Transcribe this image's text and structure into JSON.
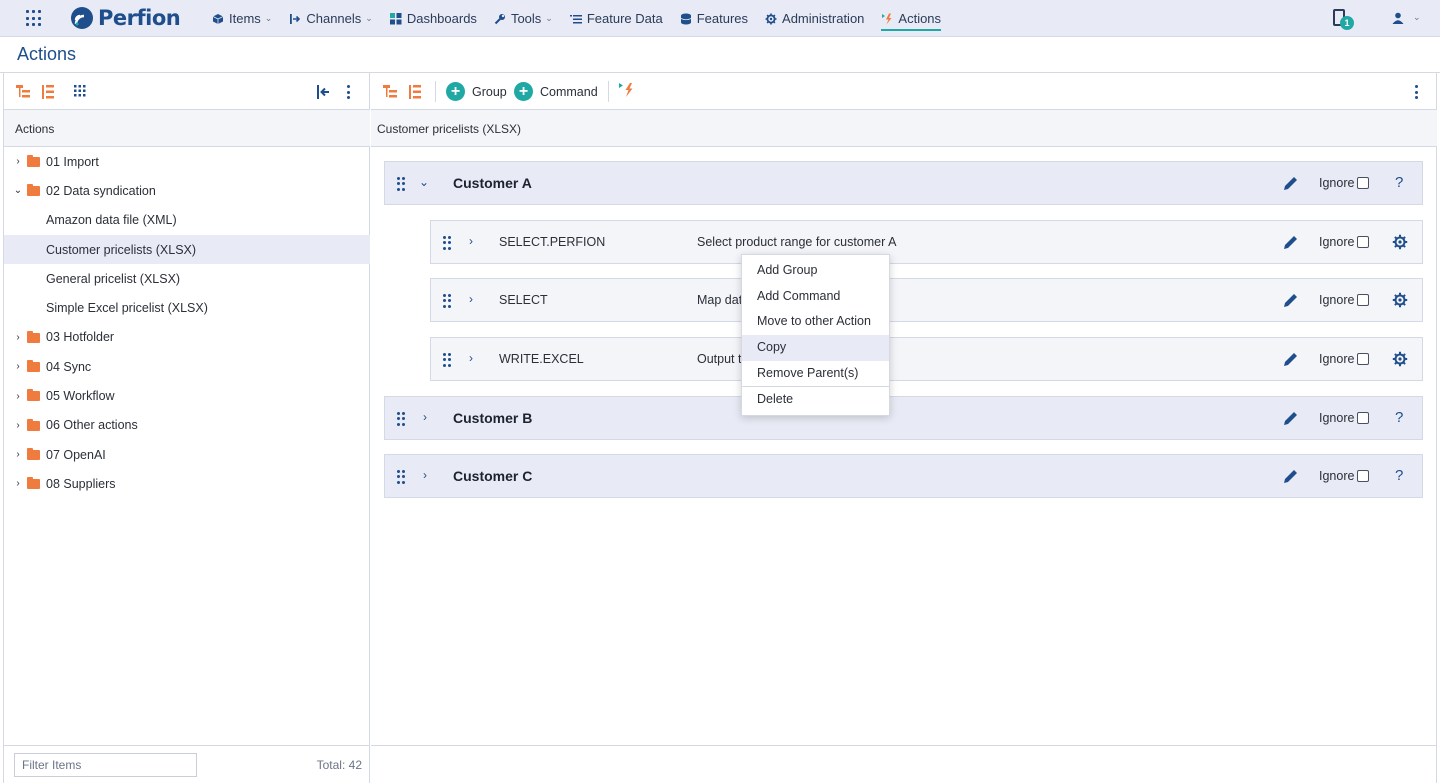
{
  "nav": {
    "brand": "Perfion",
    "items": [
      {
        "label": "Items",
        "icon": "cube-icon",
        "dropdown": true
      },
      {
        "label": "Channels",
        "icon": "channel-arrow-icon",
        "dropdown": true
      },
      {
        "label": "Dashboards",
        "icon": "dashboard-icon",
        "dropdown": false
      },
      {
        "label": "Tools",
        "icon": "wrench-icon",
        "dropdown": true
      },
      {
        "label": "Feature Data",
        "icon": "list-icon",
        "dropdown": false
      },
      {
        "label": "Features",
        "icon": "database-icon",
        "dropdown": false
      },
      {
        "label": "Administration",
        "icon": "gear-icon",
        "dropdown": false
      },
      {
        "label": "Actions",
        "icon": "bolt-icon",
        "dropdown": false,
        "active": true
      }
    ],
    "notification_count": "1"
  },
  "page_title": "Actions",
  "left_panel": {
    "header": "Actions",
    "tree": [
      {
        "label": "01 Import",
        "type": "folder",
        "expanded": false
      },
      {
        "label": "02 Data syndication",
        "type": "folder",
        "expanded": true
      },
      {
        "label": "Amazon data file (XML)",
        "type": "action"
      },
      {
        "label": "Customer pricelists (XLSX)",
        "type": "action",
        "selected": true
      },
      {
        "label": "General pricelist (XLSX)",
        "type": "action"
      },
      {
        "label": "Simple Excel pricelist (XLSX)",
        "type": "action"
      },
      {
        "label": "03 Hotfolder",
        "type": "folder",
        "expanded": false
      },
      {
        "label": "04 Sync",
        "type": "folder",
        "expanded": false
      },
      {
        "label": "05 Workflow",
        "type": "folder",
        "expanded": false
      },
      {
        "label": "06 Other actions",
        "type": "folder",
        "expanded": false
      },
      {
        "label": "07 OpenAI",
        "type": "folder",
        "expanded": false
      },
      {
        "label": "08 Suppliers",
        "type": "folder",
        "expanded": false
      }
    ],
    "filter_placeholder": "Filter Items",
    "total": "Total: 42"
  },
  "right_panel": {
    "toolbar": {
      "group_label": "Group",
      "command_label": "Command"
    },
    "header": "Customer pricelists (XLSX)",
    "ignore_label": "Ignore",
    "help_label": "?",
    "groups": [
      {
        "name": "Customer A",
        "expanded": true
      },
      {
        "name": "Customer B",
        "expanded": false
      },
      {
        "name": "Customer C",
        "expanded": false
      }
    ],
    "commands": [
      {
        "name": "SELECT.PERFION",
        "description": "Select product range for customer A"
      },
      {
        "name": "SELECT",
        "description": "Map dat"
      },
      {
        "name": "WRITE.EXCEL",
        "description": "Output t"
      }
    ]
  },
  "context_menu": {
    "items": [
      "Add Group",
      "Add Command",
      "Move to other Action",
      "Copy",
      "Remove Parent(s)",
      "Delete"
    ],
    "hovered": "Copy"
  },
  "colors": {
    "accent": "#20a9a4",
    "brand": "#1f4e8c",
    "folder": "#f07b3f"
  }
}
